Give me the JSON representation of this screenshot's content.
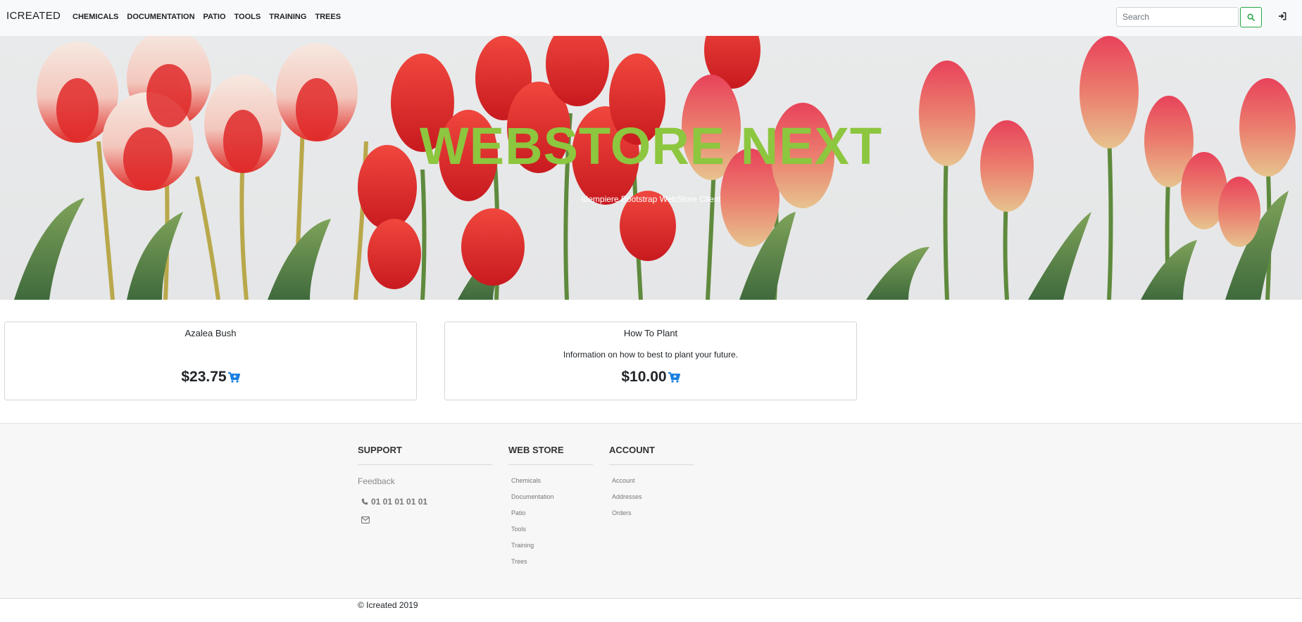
{
  "navbar": {
    "brand": "ICREATED",
    "links": [
      "CHEMICALS",
      "DOCUMENTATION",
      "PATIO",
      "TOOLS",
      "TRAINING",
      "TREES"
    ],
    "search_placeholder": "Search"
  },
  "hero": {
    "title": "WEBSTORE NEXT",
    "subtitle": "Idempiere Bootstrap WebStore Client"
  },
  "products": [
    {
      "name": "Azalea Bush",
      "description": "",
      "price": "$23.75"
    },
    {
      "name": "How To Plant",
      "description": "Information on how to best to plant your future.",
      "price": "$10.00"
    }
  ],
  "footer": {
    "support": {
      "heading": "SUPPORT",
      "feedback": "Feedback",
      "phone": "01 01 01 01 01"
    },
    "webstore": {
      "heading": "WEB STORE",
      "links": [
        "Chemicals",
        "Documentation",
        "Patio",
        "Tools",
        "Training",
        "Trees"
      ]
    },
    "account": {
      "heading": "ACCOUNT",
      "links": [
        "Account",
        "Addresses",
        "Orders"
      ]
    },
    "copyright": "© Icreated 2019"
  },
  "colors": {
    "accent_green": "#8dc63f",
    "search_border": "#28a745",
    "cart_blue": "#1a7fe0",
    "tulip_red": "#e3262a"
  },
  "icons": {
    "search": "search-icon",
    "signin": "sign-in-icon",
    "cart": "cart-plus-icon",
    "phone": "phone-icon",
    "mail": "envelope-icon"
  }
}
